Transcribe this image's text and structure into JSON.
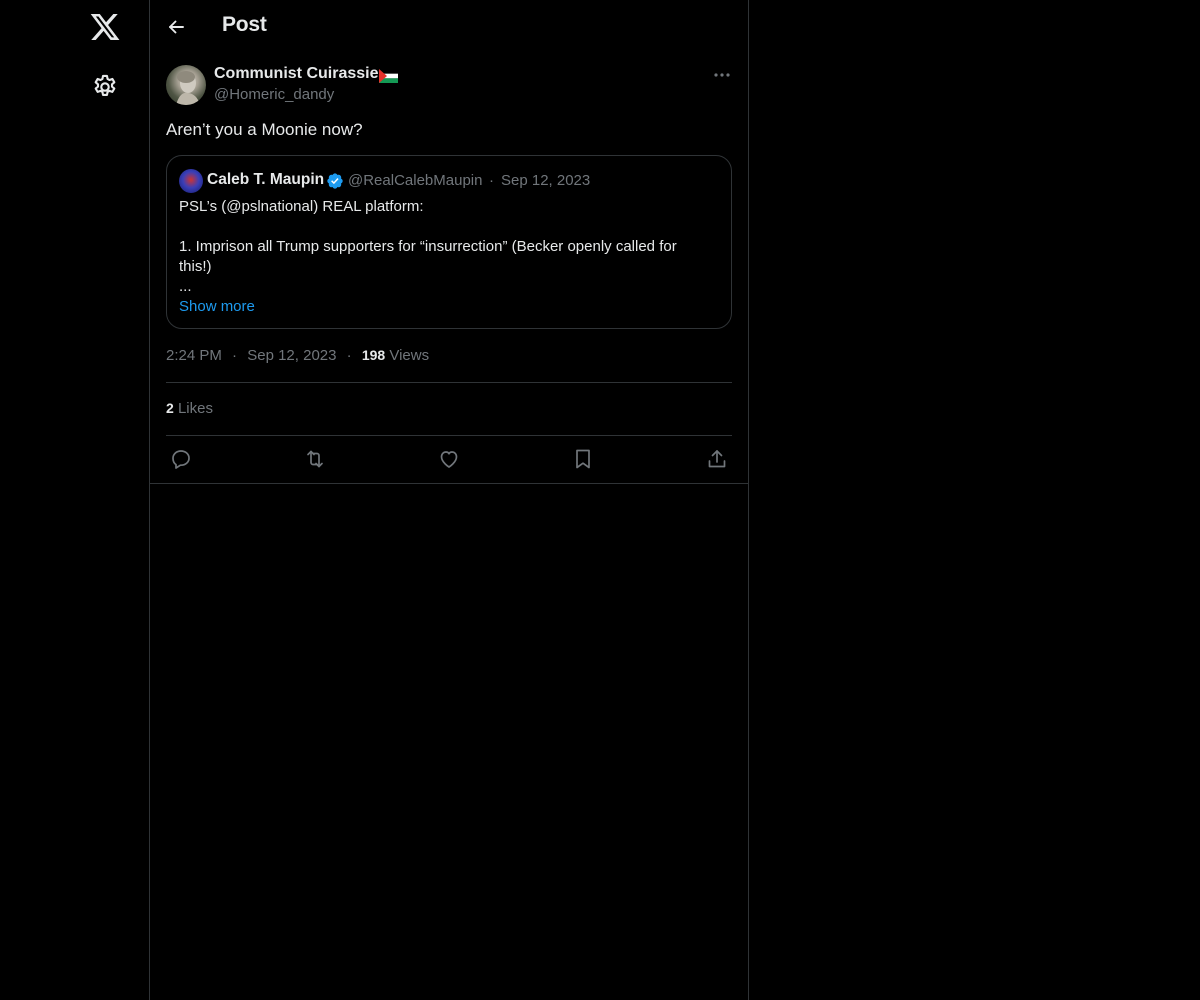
{
  "nav": {
    "logo_icon": "x-logo-icon",
    "settings_icon": "gear-icon"
  },
  "header": {
    "title": "Post",
    "back_icon": "arrow-left-icon"
  },
  "post": {
    "author_name": "Communist Cuirassier",
    "author_flag_icon": "flag-icon",
    "author_handle": "@Homeric_dandy",
    "text": "Aren’t you a Moonie now?",
    "time": "2:24 PM",
    "separator": "·",
    "date": "Sep 12, 2023",
    "views_count": "198",
    "views_label": "Views",
    "likes_count": "2",
    "likes_label": "Likes"
  },
  "quote": {
    "name": "Caleb T. Maupin",
    "handle": "@RealCalebMaupin",
    "separator": "·",
    "date": "Sep 12, 2023",
    "lines": [
      "PSL’s (@pslnational)  REAL platform:",
      "1. Imprison all Trump supporters for “insurrection” (Becker openly called for",
      "this!)",
      "..."
    ],
    "show_more": "Show more"
  },
  "colors": {
    "background": "#000000",
    "text": "#e7e9ea",
    "muted": "#71767b",
    "border": "#2f3336",
    "link": "#1d9bf0"
  }
}
